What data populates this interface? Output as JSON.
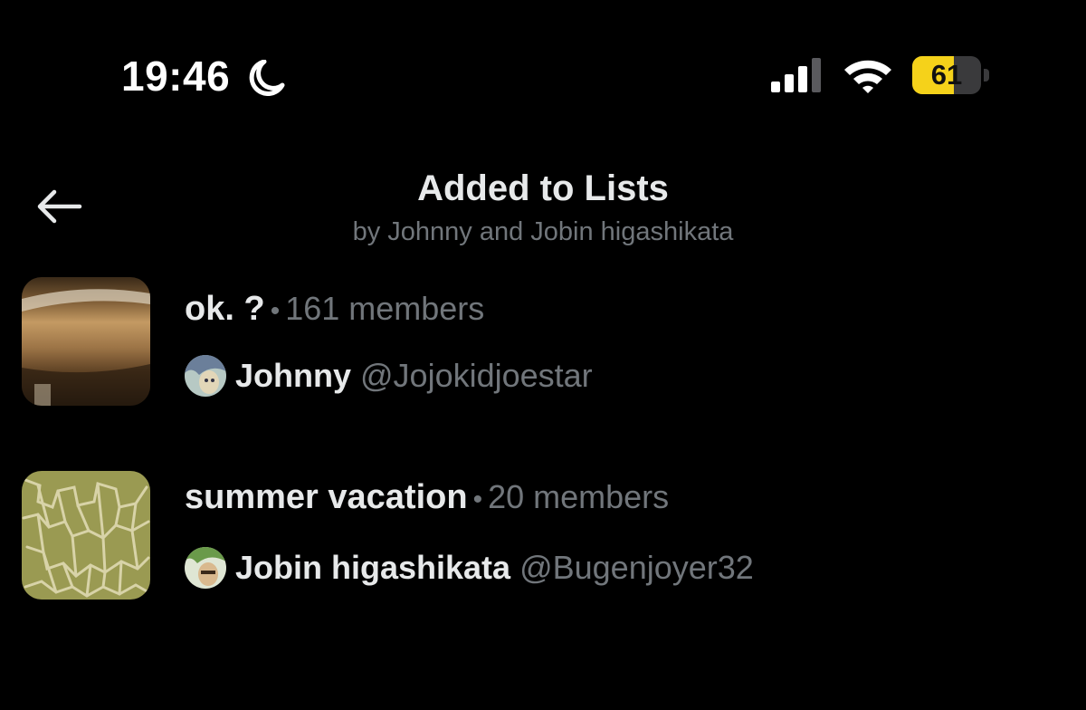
{
  "status_bar": {
    "time": "19:46",
    "battery_level": "61",
    "battery_fraction": 0.61,
    "icons": [
      "moon-icon",
      "cellular-signal-icon",
      "wifi-icon",
      "battery-icon"
    ],
    "battery_color": "#f5d21a"
  },
  "header": {
    "back_icon": "arrow-left-icon",
    "title": "Added to Lists",
    "subtitle": "by Johnny and Jobin higashikata"
  },
  "lists": [
    {
      "name": "ok. ?",
      "separator": "•",
      "members": "161 members",
      "owner_name": "Johnny",
      "owner_handle": "@Jojokidjoestar"
    },
    {
      "name": "summer vacation",
      "separator": "•",
      "members": "20 members",
      "owner_name": "Jobin higashikata",
      "owner_handle": "@Bugenjoyer32"
    }
  ],
  "colors": {
    "background": "#000000",
    "primary_text": "#e7e9ea",
    "secondary_text": "#71767b"
  }
}
